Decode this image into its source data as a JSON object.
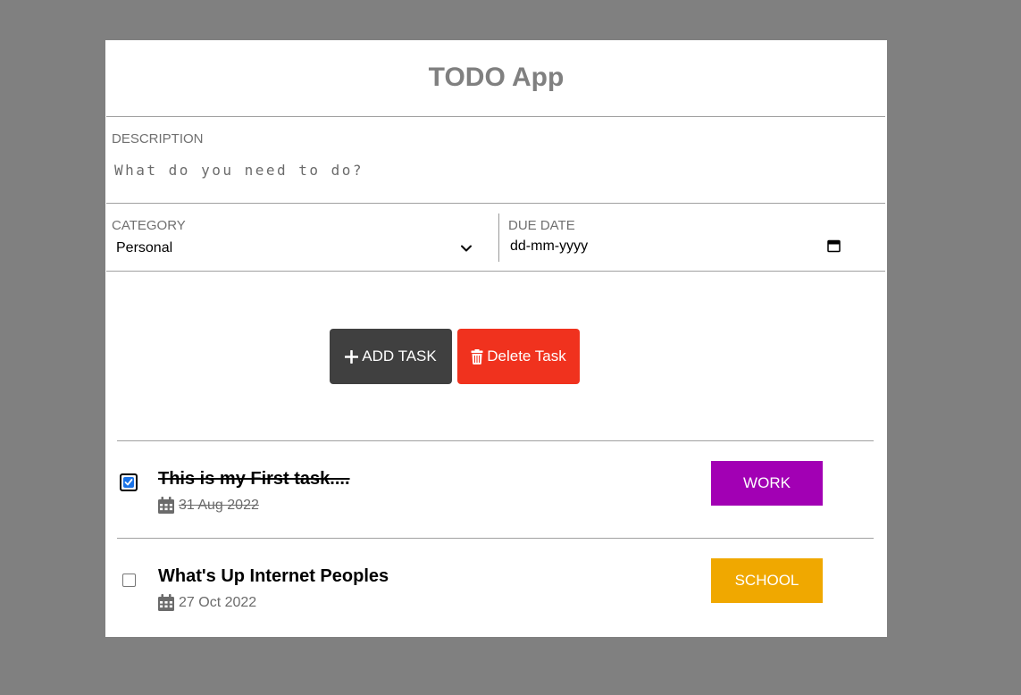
{
  "app": {
    "title": "TODO App"
  },
  "form": {
    "description": {
      "label": "DESCRIPTION",
      "placeholder": "What do you need to do?",
      "value": ""
    },
    "category": {
      "label": "CATEGORY",
      "selected": "Personal"
    },
    "due_date": {
      "label": "DUE DATE",
      "value": "dd-mm-yyyy"
    }
  },
  "actions": {
    "add_label": "ADD TASK",
    "delete_label": "Delete Task"
  },
  "icons": {
    "add": "plus-icon",
    "delete": "trash-icon",
    "date": "calendar-icon",
    "dropdown": "chevron-down-icon"
  },
  "tasks": [
    {
      "title": "This is my First task....",
      "date": "31 Aug 2022",
      "category": "WORK",
      "done": true,
      "color": "#a200b4"
    },
    {
      "title": "What's Up Internet Peoples",
      "date": "27 Oct 2022",
      "category": "SCHOOL",
      "done": false,
      "color": "#f0a800"
    }
  ],
  "colors": {
    "background": "#808080",
    "add_button": "#404040",
    "delete_button": "#f0321e",
    "checkbox_accent": "#1a73e8"
  }
}
